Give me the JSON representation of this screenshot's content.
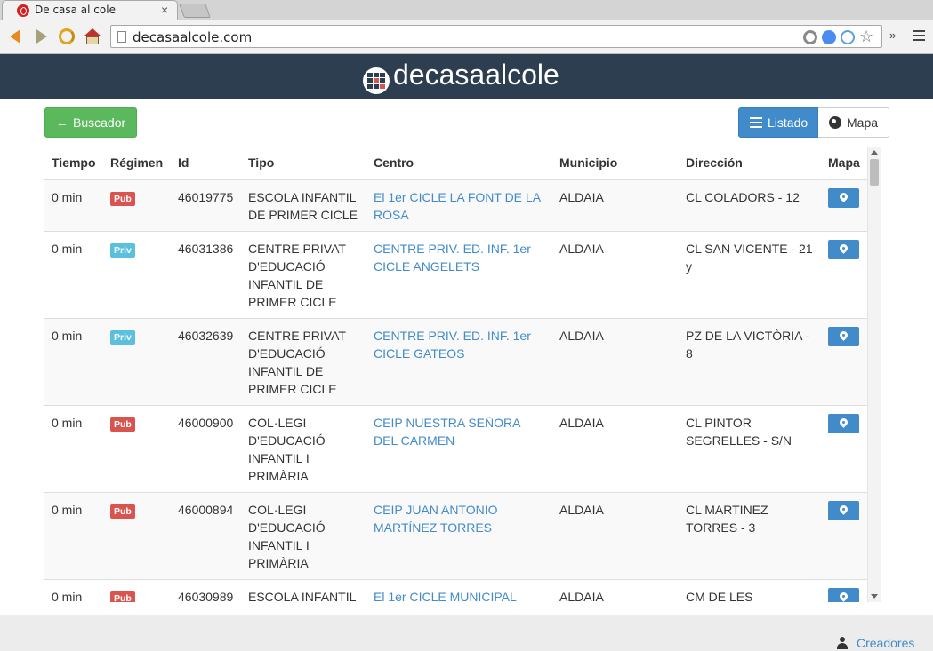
{
  "browser": {
    "tab_title": "De casa al cole",
    "tab_close": "×",
    "url": "decasaalcole.com",
    "more_label": "»"
  },
  "site": {
    "brand": "decasaalcole"
  },
  "buttons": {
    "buscador": "Buscador",
    "listado": "Listado",
    "mapa": "Mapa"
  },
  "table": {
    "headers": [
      "Tiempo",
      "Régimen",
      "Id",
      "Tipo",
      "Centro",
      "Municipio",
      "Dirección",
      "Mapa"
    ],
    "rows": [
      {
        "tiempo": "0 min",
        "regimen": "Pub",
        "id": "46019775",
        "tipo": "ESCOLA INFANTIL DE PRIMER CICLE",
        "centro": "El 1er CICLE LA FONT DE LA ROSA",
        "municipio": "ALDAIA",
        "direccion": "CL COLADORS - 12"
      },
      {
        "tiempo": "0 min",
        "regimen": "Priv",
        "id": "46031386",
        "tipo": "CENTRE PRIVAT D'EDUCACIÓ INFANTIL DE PRIMER CICLE",
        "centro": "CENTRE PRIV. ED. INF. 1er CICLE ANGELETS",
        "municipio": "ALDAIA",
        "direccion": "CL SAN VICENTE - 21 y"
      },
      {
        "tiempo": "0 min",
        "regimen": "Priv",
        "id": "46032639",
        "tipo": "CENTRE PRIVAT D'EDUCACIÓ INFANTIL DE PRIMER CICLE",
        "centro": "CENTRE PRIV. ED. INF. 1er CICLE GATEOS",
        "municipio": "ALDAIA",
        "direccion": "PZ DE LA VICTÒRIA - 8"
      },
      {
        "tiempo": "0 min",
        "regimen": "Pub",
        "id": "46000900",
        "tipo": "COL·LEGI D'EDUCACIÓ INFANTIL I PRIMÀRIA",
        "centro": "CEIP NUESTRA SEÑORA DEL CARMEN",
        "municipio": "ALDAIA",
        "direccion": "CL PINTOR SEGRELLES - S/N"
      },
      {
        "tiempo": "0 min",
        "regimen": "Pub",
        "id": "46000894",
        "tipo": "COL·LEGI D'EDUCACIÓ INFANTIL I PRIMÀRIA",
        "centro": "CEIP JUAN ANTONIO MARTÍNEZ TORRES",
        "municipio": "ALDAIA",
        "direccion": "CL MARTINEZ TORRES - 3"
      },
      {
        "tiempo": "0 min",
        "regimen": "Pub",
        "id": "46030989",
        "tipo": "ESCOLA INFANTIL",
        "centro": "El 1er CICLE MUNICIPAL",
        "municipio": "ALDAIA",
        "direccion": "CM DE LES"
      }
    ]
  },
  "footer": {
    "creadores": "Creadores"
  }
}
